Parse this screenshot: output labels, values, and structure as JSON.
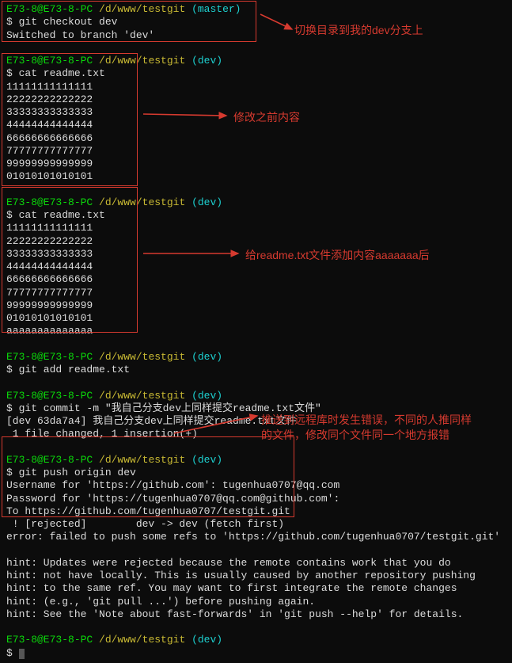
{
  "blocks": {
    "b1": {
      "prompt_user": "E73-8@E73-8-PC ",
      "prompt_path": "/d/www/testgit ",
      "prompt_branch": "(master)",
      "cmd_line": "$ git checkout dev",
      "out1": "Switched to branch 'dev'"
    },
    "b2": {
      "prompt_user": "E73-8@E73-8-PC ",
      "prompt_path": "/d/www/testgit ",
      "prompt_branch": "(dev)",
      "cmd_line": "$ cat readme.txt",
      "lines": [
        "11111111111111",
        "22222222222222",
        "33333333333333",
        "44444444444444",
        "66666666666666",
        "77777777777777",
        "99999999999999",
        "01010101010101"
      ]
    },
    "b3": {
      "prompt_user": "E73-8@E73-8-PC ",
      "prompt_path": "/d/www/testgit ",
      "prompt_branch": "(dev)",
      "cmd_line": "$ cat readme.txt",
      "lines": [
        "11111111111111",
        "22222222222222",
        "33333333333333",
        "44444444444444",
        "66666666666666",
        "77777777777777",
        "99999999999999",
        "01010101010101",
        "aaaaaaaaaaaaaa"
      ]
    },
    "b4": {
      "prompt_user": "E73-8@E73-8-PC ",
      "prompt_path": "/d/www/testgit ",
      "prompt_branch": "(dev)",
      "cmd_line": "$ git add readme.txt"
    },
    "b5": {
      "prompt_user": "E73-8@E73-8-PC ",
      "prompt_path": "/d/www/testgit ",
      "prompt_branch": "(dev)",
      "cmd_line": "$ git commit -m \"我自己分支dev上同样提交readme.txt文件\"",
      "out1": "[dev 63da7a4] 我自己分支dev上同样提交readme.txt文件",
      "out2": " 1 file changed, 1 insertion(+)"
    },
    "b6": {
      "prompt_user": "E73-8@E73-8-PC ",
      "prompt_path": "/d/www/testgit ",
      "prompt_branch": "(dev)",
      "cmd_line": "$ git push origin dev",
      "out1": "Username for 'https://github.com': tugenhua0707@qq.com",
      "out2": "Password for 'https://tugenhua0707@qq.com@github.com':",
      "out3": "To https://github.com/tugenhua0707/testgit.git",
      "out4": " ! [rejected]        dev -> dev (fetch first)",
      "out5": "error: failed to push some refs to 'https://github.com/tugenhua0707/testgit.git'",
      "h1": "hint: Updates were rejected because the remote contains work that you do",
      "h2": "hint: not have locally. This is usually caused by another repository pushing",
      "h3": "hint: to the same ref. You may want to first integrate the remote changes",
      "h4": "hint: (e.g., 'git pull ...') before pushing again.",
      "h5": "hint: See the 'Note about fast-forwards' in 'git push --help' for details."
    },
    "b7": {
      "prompt_user": "E73-8@E73-8-PC ",
      "prompt_path": "/d/www/testgit ",
      "prompt_branch": "(dev)",
      "cmd_line": "$ "
    }
  },
  "annotations": {
    "a1": "切换目录到我的dev分支上",
    "a2": "修改之前内容",
    "a3": "给readme.txt文件添加内容aaaaaaa后",
    "a4_l1": "推送到远程库时发生错误，不同的人推同样",
    "a4_l2": "的文件，修改同个文件同一个地方报错"
  }
}
